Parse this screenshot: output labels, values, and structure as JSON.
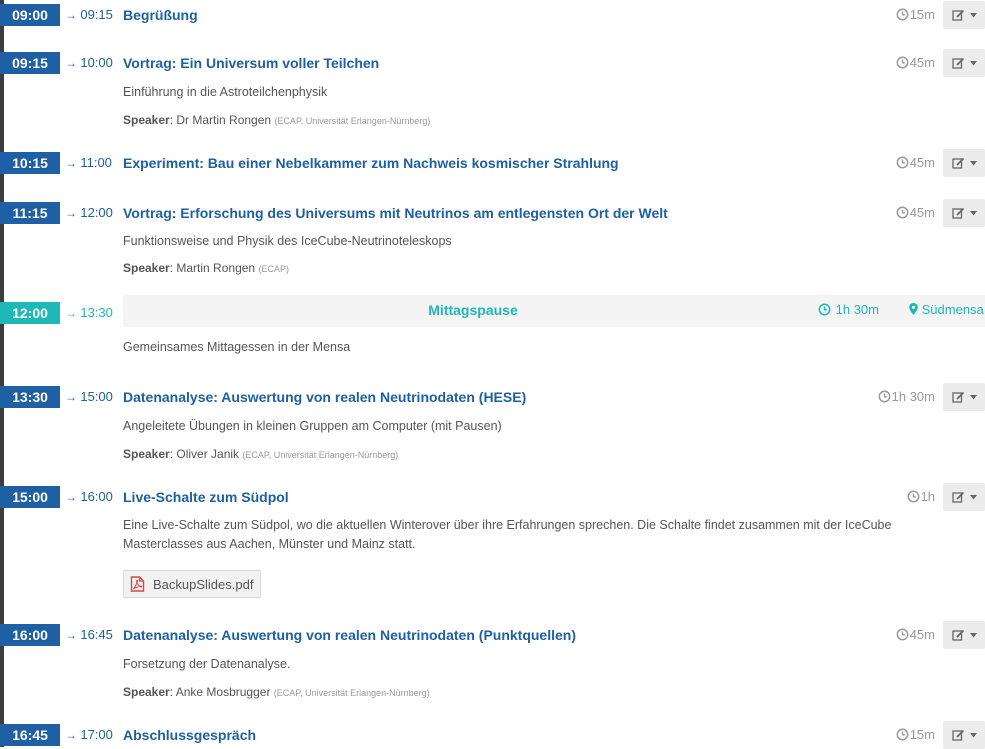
{
  "timetable": {
    "entries": [
      {
        "start": "09:00",
        "end": "09:15",
        "title": "Begrüßung",
        "duration": "15m"
      },
      {
        "start": "09:15",
        "end": "10:00",
        "title": "Vortrag: Ein Universum voller Teilchen",
        "duration": "45m",
        "description": "Einführung in die Astroteilchenphysik",
        "speaker_label": "Speaker",
        "speaker": "Dr Martin Rongen",
        "affiliation": "(ECAP, Universität Erlangen-Nürnberg)"
      },
      {
        "start": "10:15",
        "end": "11:00",
        "title": "Experiment: Bau einer Nebelkammer zum Nachweis kosmischer Strahlung",
        "duration": "45m"
      },
      {
        "start": "11:15",
        "end": "12:00",
        "title": "Vortrag: Erforschung des Universums mit Neutrinos am entlegensten Ort der Welt",
        "duration": "45m",
        "description": "Funktionsweise und Physik des IceCube-Neutrinoteleskops",
        "speaker_label": "Speaker",
        "speaker": "Martin Rongen",
        "affiliation": "(ECAP)"
      },
      {
        "start": "12:00",
        "end": "13:30",
        "title": "Mittagspause",
        "duration": "1h 30m",
        "location": "Südmensa",
        "description": "Gemeinsames Mittagessen in der Mensa"
      },
      {
        "start": "13:30",
        "end": "15:00",
        "title": "Datenanalyse: Auswertung von realen Neutrinodaten (HESE)",
        "duration": "1h 30m",
        "description": "Angeleitete Übungen in kleinen Gruppen am Computer (mit Pausen)",
        "speaker_label": "Speaker",
        "speaker": "Oliver Janik",
        "affiliation": "(ECAP, Universität Erlangen-Nürnberg)"
      },
      {
        "start": "15:00",
        "end": "16:00",
        "title": "Live-Schalte zum Südpol",
        "duration": "1h",
        "description_line1": "Eine Live-Schalte zum Südpol, wo die aktuellen Winterover über ihre Erfahrungen sprechen. Die Schalte findet zusammen mit der IceCube",
        "description_line2": "Masterclasses aus Aachen, Münster und Mainz statt.",
        "attachment": "BackupSlides.pdf"
      },
      {
        "start": "16:00",
        "end": "16:45",
        "title": "Datenanalyse: Auswertung von realen Neutrinodaten (Punktquellen)",
        "duration": "45m",
        "description": "Forsetzung der Datenanalyse.",
        "speaker_label": "Speaker",
        "speaker": "Anke Mosbrugger",
        "affiliation": "(ECAP, Universität Erlangen-Nürnberg)"
      },
      {
        "start": "16:45",
        "end": "17:00",
        "title": "Abschlussgespräch",
        "duration": "15m"
      }
    ]
  },
  "colors": {
    "primary": "#1f5fa3",
    "break": "#1fb8b8",
    "timeline": "#3d3d3d",
    "muted": "#999999"
  },
  "icons": {
    "clock": "clock-icon",
    "edit": "edit-icon",
    "caret": "caret-down-icon",
    "pin": "map-marker-icon",
    "pdf": "pdf-file-icon"
  }
}
